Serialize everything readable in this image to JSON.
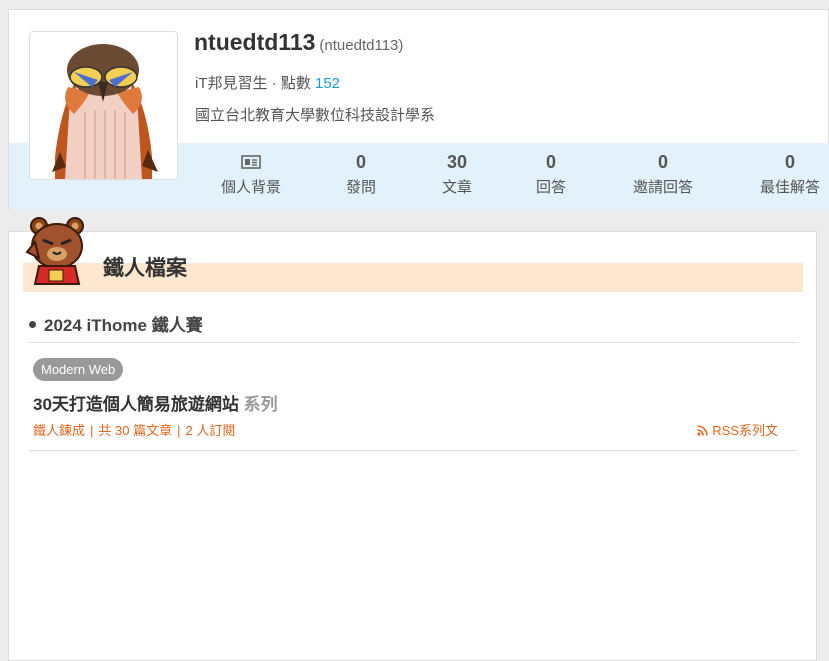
{
  "profile": {
    "username": "ntuedtd113",
    "userid": "(ntuedtd113)",
    "rank": "iT邦見習生 · 點數",
    "points": "152",
    "school": "國立台北教育大學數位科技設計學系",
    "stats": [
      {
        "icon": "profile-card-icon",
        "value": "",
        "label": "個人背景"
      },
      {
        "value": "0",
        "label": "發問"
      },
      {
        "value": "30",
        "label": "文章"
      },
      {
        "value": "0",
        "label": "回答"
      },
      {
        "value": "0",
        "label": "邀請回答"
      },
      {
        "value": "0",
        "label": "最佳解答"
      }
    ]
  },
  "ironman": {
    "section_title": "鐵人檔案",
    "event": "2024 iThome 鐵人賽",
    "tag": "Modern Web",
    "series_title": "30天打造個人簡易旅遊網站",
    "series_suffix": "系列",
    "status": "鐵人鍊成",
    "article_count": "共 30 篇文章",
    "subscribers": "2 人訂閱",
    "rss_label": "RSS系列文"
  },
  "colors": {
    "accent_orange": "#e0661d",
    "link_blue": "#1a9bd7",
    "stats_band": "#e2f1fa",
    "section_band": "#fde8cf"
  }
}
